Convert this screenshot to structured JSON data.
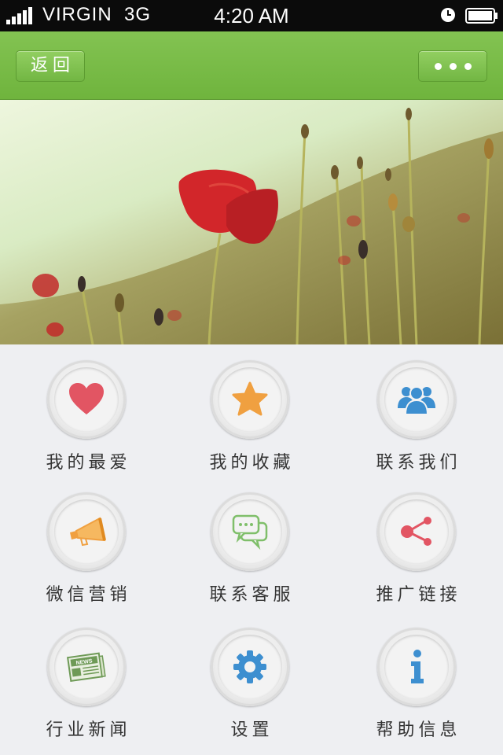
{
  "status_bar": {
    "carrier": "VIRGIN",
    "network": "3G",
    "time": "4:20 AM"
  },
  "nav": {
    "back_label": "返回",
    "more_label": "•••"
  },
  "colors": {
    "nav_green": "#77ba47",
    "heart": "#e25563",
    "star": "#f0a040",
    "people": "#3d8fd0",
    "megaphone": "#f0a040",
    "chat": "#7fbf6a",
    "share": "#e25563",
    "news": "#6e9a56",
    "gear": "#3d8fd0",
    "info": "#3d8fd0"
  },
  "menu": [
    {
      "label": "我的最爱",
      "icon": "heart-icon"
    },
    {
      "label": "我的收藏",
      "icon": "star-icon"
    },
    {
      "label": "联系我们",
      "icon": "people-icon"
    },
    {
      "label": "微信营销",
      "icon": "megaphone-icon"
    },
    {
      "label": "联系客服",
      "icon": "chat-icon"
    },
    {
      "label": "推广链接",
      "icon": "share-icon"
    },
    {
      "label": "行业新闻",
      "icon": "newspaper-icon",
      "icon_text": "NEWS"
    },
    {
      "label": "设置",
      "icon": "gear-icon"
    },
    {
      "label": "帮助信息",
      "icon": "info-icon"
    }
  ]
}
